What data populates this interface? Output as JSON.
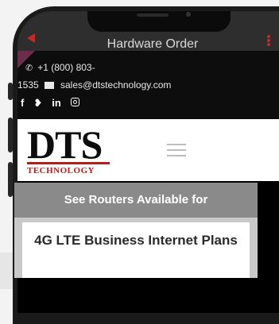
{
  "app_bar": {
    "title": "Hardware Order"
  },
  "contact": {
    "phone_part1": "+1 (800) 803-",
    "phone_part2": "1535",
    "email": "sales@dtstechnology.com"
  },
  "social": {
    "facebook": "f",
    "twitter": "❥",
    "linkedin": "in"
  },
  "logo": {
    "main": "DTS",
    "sub": "TECHNOLOGY"
  },
  "banner": {
    "heading": "See Routers Available for",
    "subheading": "4G LTE Business Internet Plans"
  },
  "colors": {
    "brand_red": "#b71c1c",
    "app_bar": "#2e2e2e",
    "page_bg": "#0d0d0d"
  }
}
